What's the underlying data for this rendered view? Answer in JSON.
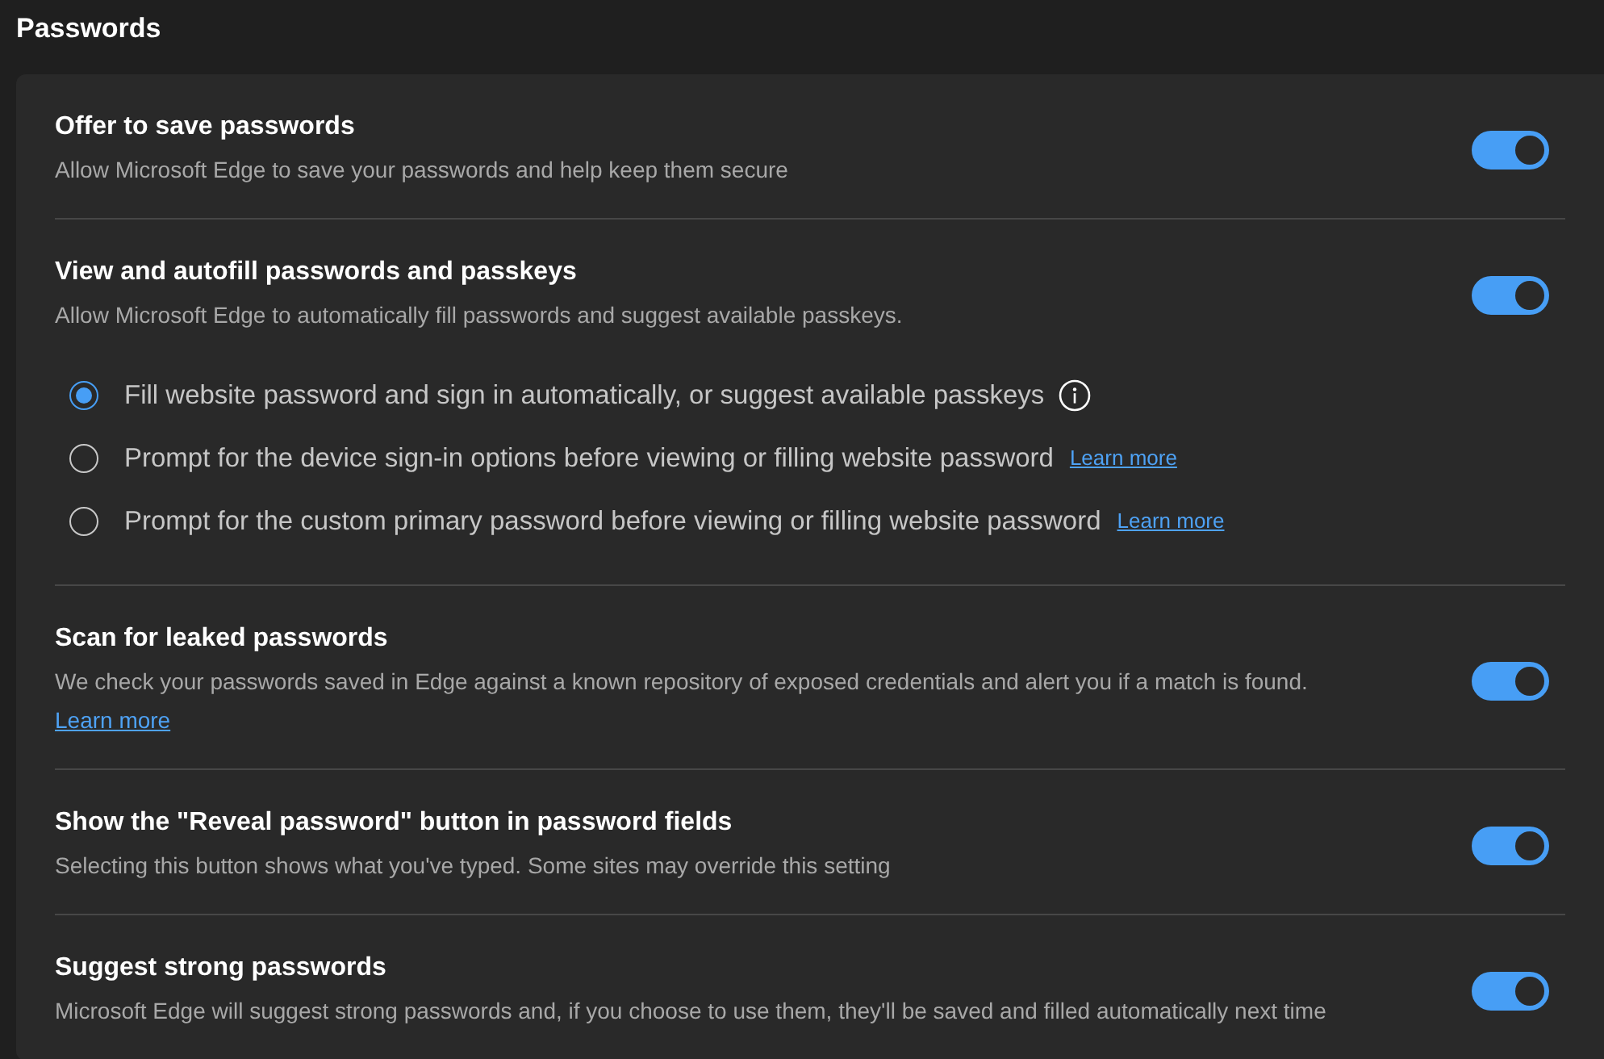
{
  "page": {
    "title": "Passwords"
  },
  "settings": [
    {
      "title": "Offer to save passwords",
      "description": "Allow Microsoft Edge to save your passwords and help keep them secure",
      "on": true
    },
    {
      "title": "View and autofill passwords and passkeys",
      "description": "Allow Microsoft Edge to automatically fill passwords and suggest available passkeys.",
      "on": true,
      "options": [
        {
          "label": "Fill website password and sign in automatically, or suggest available passkeys",
          "selected": true,
          "info_icon": true
        },
        {
          "label": "Prompt for the device sign-in options before viewing or filling website password",
          "selected": false,
          "link": "Learn more"
        },
        {
          "label": "Prompt for the custom primary password before viewing or filling website password",
          "selected": false,
          "link": "Learn more"
        }
      ]
    },
    {
      "title": "Scan for leaked passwords",
      "description": "We check your passwords saved in Edge against a known repository of exposed credentials and alert you if a match is found.",
      "link": "Learn more",
      "on": true
    },
    {
      "title": "Show the \"Reveal password\" button in password fields",
      "description": "Selecting this button shows what you've typed. Some sites may override this setting",
      "on": true
    },
    {
      "title": "Suggest strong passwords",
      "description": "Microsoft Edge will suggest strong passwords and, if you choose to use them, they'll be saved and filled automatically next time",
      "on": true
    }
  ]
}
